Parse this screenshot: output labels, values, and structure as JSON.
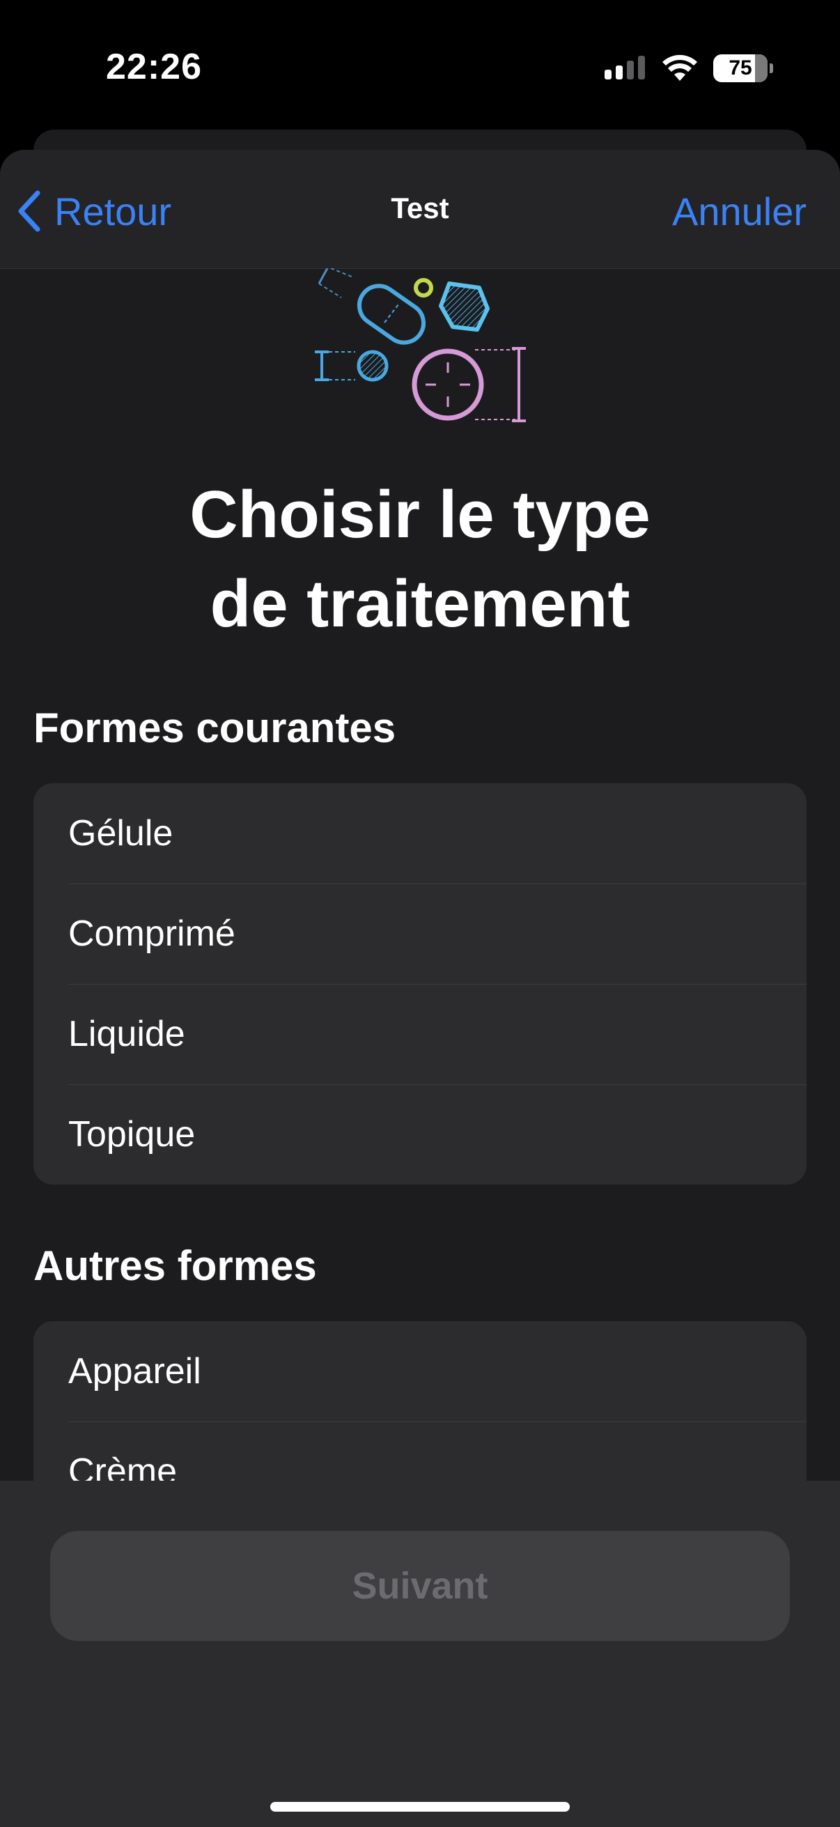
{
  "status_bar": {
    "time": "22:26",
    "battery_level": "75"
  },
  "nav": {
    "back_label": "Retour",
    "title": "Test",
    "cancel_label": "Annuler"
  },
  "main": {
    "title_line1": "Choisir le type",
    "title_line2": "de traitement"
  },
  "sections": {
    "common": {
      "header": "Formes courantes",
      "items": [
        "Gélule",
        "Comprimé",
        "Liquide",
        "Topique"
      ]
    },
    "other": {
      "header": "Autres formes",
      "items": [
        "Appareil",
        "Crème"
      ]
    }
  },
  "footer": {
    "next_label": "Suivant"
  },
  "colors": {
    "accent": "#3a82f7",
    "background": "#1c1c1e",
    "cell": "#2c2c2e",
    "disabled_button": "#3f3f42",
    "disabled_text": "#6c6c70"
  }
}
